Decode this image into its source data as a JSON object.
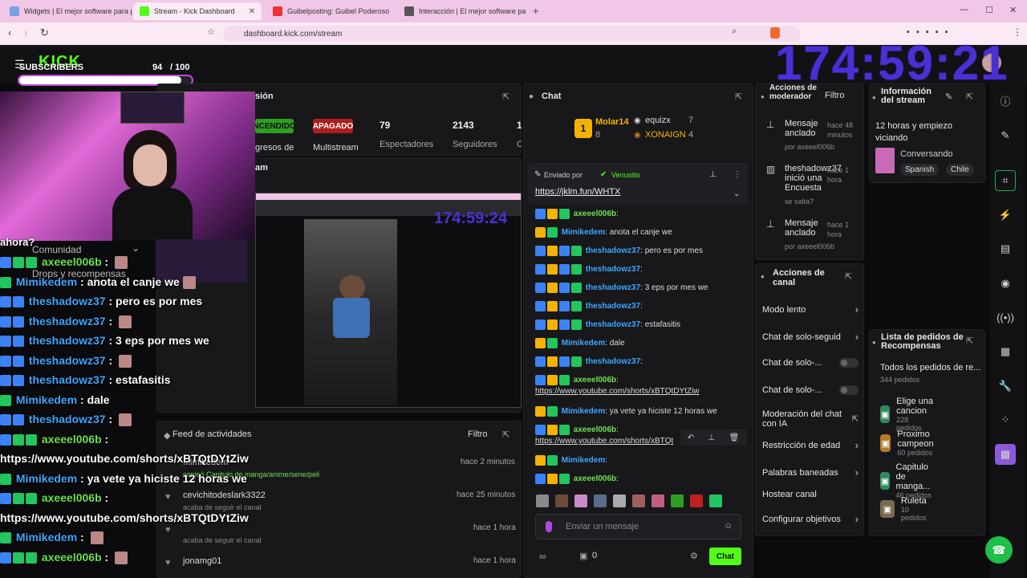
{
  "browser": {
    "tabs": [
      {
        "title": "Widgets | El mejor software para pot",
        "favicon_color": "#7aa0e8"
      },
      {
        "title": "Stream - Kick Dashboard",
        "favicon_color": "#53fc18"
      },
      {
        "title": "Guibelposting: Guibel Poderoso",
        "favicon_color": "#e33"
      },
      {
        "title": "Interacción | El mejor software pa",
        "favicon_color": "#555"
      }
    ],
    "url": "dashboard.kick.com/stream"
  },
  "overlay": {
    "subs_label": "SUBSCRIBERS",
    "subs_count": "94",
    "subs_goal": "/ 100",
    "subs_progress": 0.94,
    "timer": "174:59:21",
    "inner_timer": "174:59:24",
    "ahora": "ahora?",
    "chat": [
      {
        "user": "axeeel006b",
        "text": " : ",
        "color": "green",
        "badges": [
          "bb",
          "bg",
          "bg"
        ],
        "thumb": true
      },
      {
        "user": "Mimikedem",
        "text": " : anota el canje we",
        "color": "blue",
        "badges": [
          "bg"
        ],
        "thumb": true
      },
      {
        "user": "theshadowz37",
        "text": " : pero es por mes",
        "color": "blue",
        "badges": [
          "bb",
          "bb"
        ],
        "thumb": false
      },
      {
        "user": "theshadowz37",
        "text": " : ",
        "color": "blue",
        "badges": [
          "bb",
          "bb"
        ],
        "thumb": true
      },
      {
        "user": "theshadowz37",
        "text": " : 3 eps por mes we",
        "color": "blue",
        "badges": [
          "bb",
          "bb"
        ],
        "thumb": false
      },
      {
        "user": "theshadowz37",
        "text": " : ",
        "color": "blue",
        "badges": [
          "bb",
          "bb"
        ],
        "thumb": true
      },
      {
        "user": "theshadowz37",
        "text": " : estafasitis",
        "color": "blue",
        "badges": [
          "bb",
          "bb"
        ],
        "thumb": false
      },
      {
        "user": "Mimikedem",
        "text": " : dale",
        "color": "blue",
        "badges": [
          "bg"
        ],
        "thumb": false
      },
      {
        "user": "theshadowz37",
        "text": " : ",
        "color": "blue",
        "badges": [
          "bb",
          "bb"
        ],
        "thumb": true
      },
      {
        "user": "axeeel006b",
        "text": " : ",
        "color": "green",
        "badges": [
          "bb",
          "bg",
          "bg"
        ],
        "thumb": false
      },
      {
        "user": "",
        "text": "https://www.youtube.com/shorts/xBTQtDYtZiw",
        "color": "white",
        "badges": [],
        "thumb": false
      },
      {
        "user": "Mimikedem",
        "text": " : ya vete ya hiciste 12 horas we",
        "color": "blue",
        "badges": [
          "bg"
        ],
        "thumb": false
      },
      {
        "user": "axeeel006b",
        "text": " : ",
        "color": "green",
        "badges": [
          "bb",
          "bg",
          "bg"
        ],
        "thumb": false
      },
      {
        "user": "",
        "text": "https://www.youtube.com/shorts/xBTQtDYtZiw",
        "color": "white",
        "badges": [],
        "thumb": false
      },
      {
        "user": "Mimikedem",
        "text": " : ",
        "color": "blue",
        "badges": [
          "bg"
        ],
        "thumb": true
      },
      {
        "user": "axeeel006b",
        "text": " : ",
        "color": "green",
        "badges": [
          "bb",
          "bg",
          "bg"
        ],
        "thumb": true
      }
    ]
  },
  "session": {
    "title_partial": "sión",
    "status_on": "NCENDIDO",
    "status_off": "APAGADO",
    "ingresos_label": "gresos de",
    "multistream_label": "Multistream",
    "viewers_value": "79",
    "viewers_label": "Espectadores",
    "followers_value": "2143",
    "followers_label": "Seguidores",
    "extra_value": "1:",
    "extra_label": "C",
    "preview_label": "am",
    "community_label": "Comunidad",
    "drops_label": "Drops y recompensas"
  },
  "activity": {
    "title": "Feed de actividades",
    "filter": "Filtro",
    "items": [
      {
        "user": "Mimikedem",
        "detail": "canjeó Capitulo de manga/anime/serie/peli",
        "time": "hace 2 minutos"
      },
      {
        "user": "cevichitodeslark3322",
        "detail": "acaba de seguir el canal",
        "time": "hace 25 minutos"
      },
      {
        "user": "",
        "detail": "acaba de seguir el canal",
        "time": "hace 1 hora"
      },
      {
        "user": "jonamg01",
        "detail": "",
        "time": "hace 1 hora"
      }
    ]
  },
  "chat": {
    "title": "Chat",
    "leaderboard": {
      "top_name": "Molar14",
      "top_count": "8",
      "second_name": "equizx",
      "second_count": "7",
      "third_name": "XONAIGN",
      "third_count": "4",
      "rank": "1"
    },
    "pinned_by_label": "Enviado por",
    "pinned_by_user": "Venusitis",
    "pinned_link": "https://jklm.fun/WHTX",
    "messages": [
      {
        "user": "axeeel006b",
        "text": ":",
        "color": "green",
        "badges": [
          "bb",
          "by",
          "bg"
        ]
      },
      {
        "user": "Mimikedem",
        "text": ": anota el canje we",
        "color": "blue",
        "badges": [
          "by",
          "bg"
        ]
      },
      {
        "user": "theshadowz37",
        "text": ": pero es por mes",
        "color": "blue",
        "badges": [
          "bb",
          "by",
          "bb",
          "bg"
        ]
      },
      {
        "user": "theshadowz37",
        "text": ":",
        "color": "blue",
        "badges": [
          "bb",
          "by",
          "bb",
          "bg"
        ]
      },
      {
        "user": "theshadowz37",
        "text": ": 3 eps por mes we",
        "color": "blue",
        "badges": [
          "bb",
          "by",
          "bb",
          "bg"
        ]
      },
      {
        "user": "theshadowz37",
        "text": ":",
        "color": "blue",
        "badges": [
          "bb",
          "by",
          "bb",
          "bg"
        ]
      },
      {
        "user": "theshadowz37",
        "text": ": estafasitis",
        "color": "blue",
        "badges": [
          "bb",
          "by",
          "bb",
          "bg"
        ]
      },
      {
        "user": "Mimikedem",
        "text": ": dale",
        "color": "blue",
        "badges": [
          "by",
          "bg"
        ]
      },
      {
        "user": "theshadowz37",
        "text": ":",
        "color": "blue",
        "badges": [
          "bb",
          "by",
          "bb",
          "bg"
        ]
      },
      {
        "user": "axeeel006b",
        "text": ":",
        "color": "green",
        "badges": [
          "bb",
          "by",
          "bg"
        ]
      },
      {
        "user": "",
        "text": "https://www.youtube.com/shorts/xBTQtDYtZiw",
        "color": "link",
        "badges": []
      },
      {
        "user": "Mimikedem",
        "text": ": ya vete ya hiciste 12 horas we",
        "color": "blue",
        "badges": [
          "by",
          "bg"
        ]
      },
      {
        "user": "axeeel006b",
        "text": ":",
        "color": "green",
        "badges": [
          "bb",
          "by",
          "bg"
        ]
      },
      {
        "user": "",
        "text": "https://www.youtube.com/shorts/xBTQt",
        "color": "link",
        "badges": []
      },
      {
        "user": "Mimikedem",
        "text": ":",
        "color": "blue",
        "badges": [
          "by",
          "bg"
        ]
      },
      {
        "user": "axeeel006b",
        "text": ":",
        "color": "green",
        "badges": [
          "bb",
          "by",
          "bg"
        ]
      }
    ],
    "input_placeholder": "Enviar un mensaje",
    "points_value": "0",
    "send_label": "Chat"
  },
  "mod_actions": {
    "title": "Acciones de moderador",
    "filter": "Filtro",
    "items": [
      {
        "title": "Mensaje anclado",
        "by": "por axeeel006b",
        "time": "hace 48 minutos",
        "icon": "pin-icon"
      },
      {
        "title": "theshadowz37 inició una Encuesta",
        "by": "se salta?",
        "time": "hace 1 hora",
        "icon": "poll-icon"
      },
      {
        "title": "Mensaje anclado",
        "by": "por axeeel006b",
        "time": "hace 1 hora",
        "icon": "pin-icon"
      }
    ]
  },
  "channel_actions": {
    "title": "Acciones de canal",
    "items": [
      {
        "label": "Modo lento",
        "control": "chevron"
      },
      {
        "label": "Chat de solo-seguid",
        "control": "chevron"
      },
      {
        "label": "Chat de solo-...",
        "control": "toggle"
      },
      {
        "label": "Chat de solo-...",
        "control": "toggle"
      },
      {
        "label": "Moderación del chat con IA",
        "control": "external"
      },
      {
        "label": "Restricción de edad",
        "control": "chevron"
      },
      {
        "label": "Palabras baneadas",
        "control": "chevron"
      },
      {
        "label": "Hostear canal",
        "control": "none"
      },
      {
        "label": "Configurar objetivos",
        "control": "chevron"
      }
    ]
  },
  "stream_info": {
    "title": "Información del stream",
    "stream_title": "12 horas y empiezo viciando",
    "category": "Conversando",
    "tags": [
      "Spanish",
      "Chile"
    ]
  },
  "rewards": {
    "title": "Lista de pedidos de Recompensas",
    "all_label": "Todos los pedidos de re...",
    "all_count": "344 pedidos",
    "items": [
      {
        "name": "Elige una cancion",
        "count": "228 pedidos",
        "color": "#2f8a5a"
      },
      {
        "name": "Proximo campeon",
        "count": "60 pedidos",
        "color": "#b87a2a"
      },
      {
        "name": "Capitulo de manga...",
        "count": "46 pedidos",
        "color": "#2f8a5a"
      },
      {
        "name": "Ruleta",
        "count": "10 pedidos",
        "color": "#7a6a50"
      }
    ]
  }
}
